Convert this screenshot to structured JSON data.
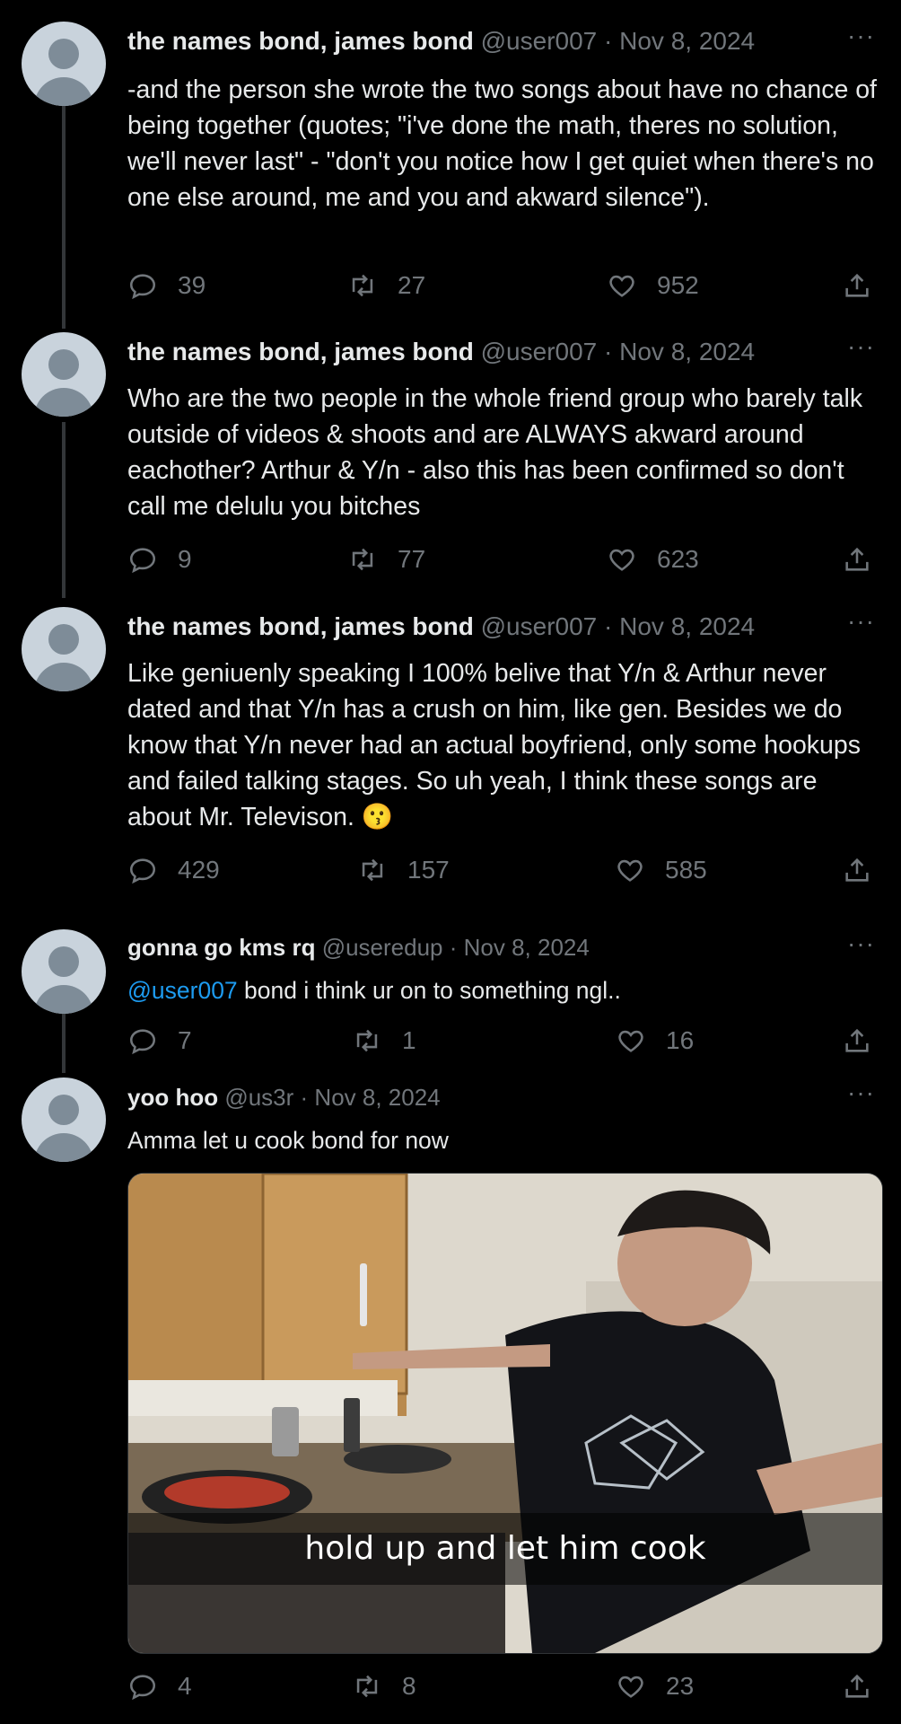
{
  "tweets": [
    {
      "name": "the names bond, james bond",
      "handle": "@user007",
      "date": "· Nov 8, 2024",
      "text": "-and the person she wrote the two songs about have no chance of being together (quotes; \"i've done the math, theres no solution, we'll never last\" - \"don't you notice how I get quiet when there's no one else around, me and you and akward silence\").",
      "replies": "39",
      "retweets": "27",
      "likes": "952"
    },
    {
      "name": "the names bond, james bond",
      "handle": "@user007",
      "date": "· Nov 8, 2024",
      "text": "Who are the two people in the whole friend group who barely talk outside of videos & shoots and are ALWAYS akward around eachother? Arthur & Y/n - also this has been confirmed so don't call me delulu you bitches",
      "replies": "9",
      "retweets": "77",
      "likes": "623"
    },
    {
      "name": "the names bond, james bond",
      "handle": "@user007",
      "date": "· Nov 8, 2024",
      "text": "Like geniuenly speaking I 100% belive that Y/n & Arthur never dated and that Y/n has a crush on him, like gen. Besides we do know that Y/n never had an actual boyfriend, only some hookups and failed talking stages. So uh yeah, I think these songs are about Mr. Televison. 😗",
      "replies": "429",
      "retweets": "157",
      "likes": "585"
    },
    {
      "name": "gonna go kms rq",
      "handle": "@useredup",
      "date": "· Nov 8, 2024",
      "mention": "@user007",
      "text": " bond i think ur on to something ngl..",
      "replies": "7",
      "retweets": "1",
      "likes": "16"
    },
    {
      "name": "yoo hoo",
      "handle": "@us3r",
      "date": "· Nov 8, 2024",
      "text": "Amma let u cook bond for now",
      "image_caption": "hold up and let him cook",
      "replies": "4",
      "retweets": "8",
      "likes": "23"
    }
  ],
  "icons": {
    "reply": "reply-icon",
    "retweet": "retweet-icon",
    "like": "heart-icon",
    "share": "share-icon",
    "more": "more-icon"
  },
  "more_glyph": "···",
  "colors": {
    "background": "#000000",
    "text": "#e7e9ea",
    "secondary": "#71767b",
    "link": "#1d9bf0"
  }
}
